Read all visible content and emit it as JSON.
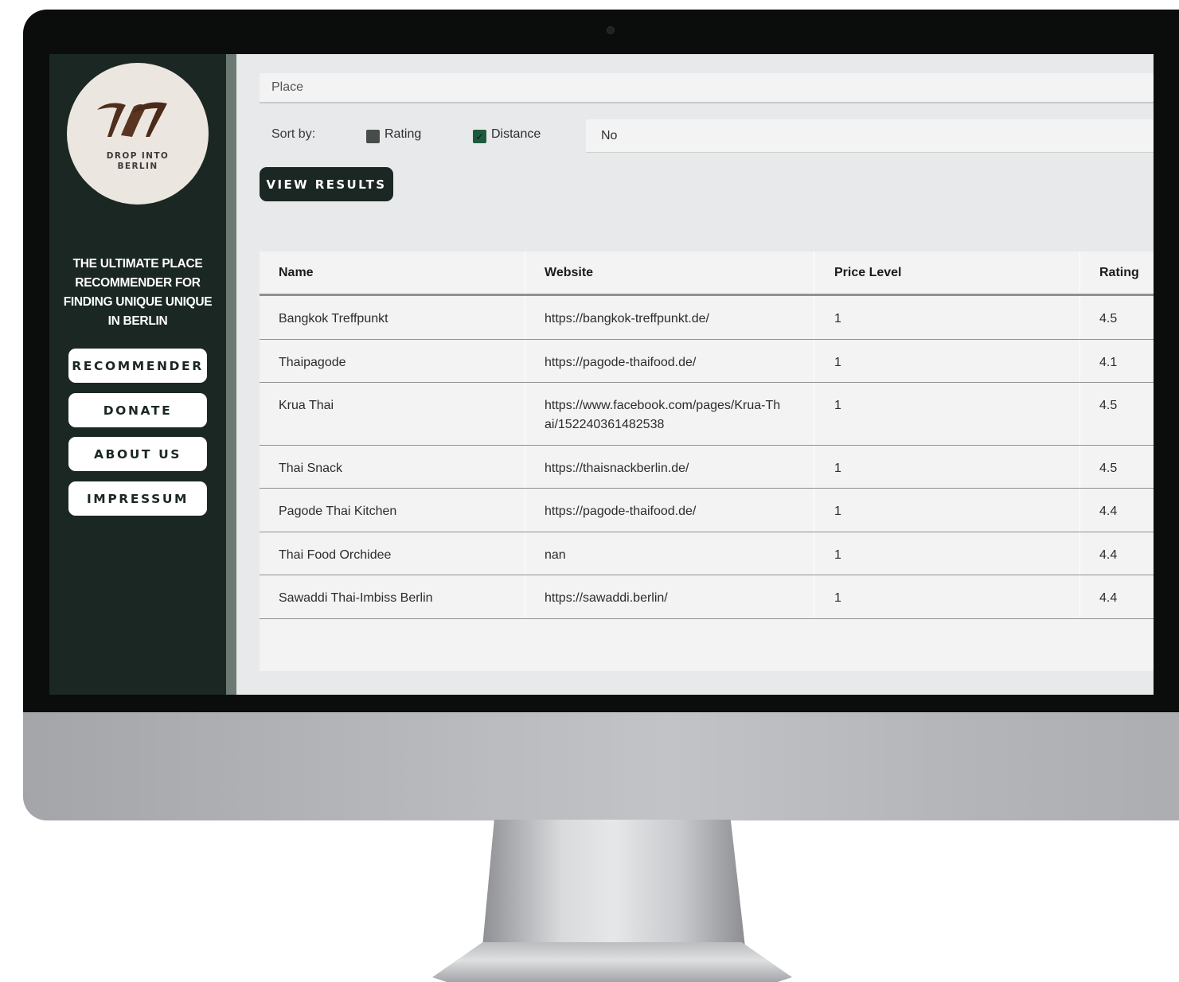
{
  "brand": {
    "logo_text": "DROP INTO BERLIN",
    "tagline": "THE ULTIMATE PLACE RECOMMENDER FOR FINDING UNIQUE UNIQUE IN BERLIN"
  },
  "nav": {
    "items": [
      {
        "label": "RECOMMENDER"
      },
      {
        "label": "DONATE"
      },
      {
        "label": "ABOUT US"
      },
      {
        "label": "IMPRESSUM"
      }
    ]
  },
  "search": {
    "placeholder": "Place"
  },
  "sort": {
    "label": "Sort by:",
    "options": [
      {
        "label": "Rating",
        "checked": false
      },
      {
        "label": "Distance",
        "checked": true
      }
    ],
    "select_value": "No"
  },
  "actions": {
    "view_results_label": "VIEW RESULTS"
  },
  "colors": {
    "sidebar": "#1b2723",
    "accent": "#1f5a3d",
    "background": "#e8e9ea"
  },
  "table": {
    "columns": [
      "Name",
      "Website",
      "Price Level",
      "Rating"
    ],
    "rows": [
      [
        "Bangkok Treffpunkt",
        "https://bangkok-treffpunkt.de/",
        "1",
        "4.5"
      ],
      [
        "Thaipagode",
        "https://pagode-thaifood.de/",
        "1",
        "4.1"
      ],
      [
        "Krua Thai",
        "https://www.facebook.com/pages/Krua-Thai/152240361482538",
        "1",
        "4.5"
      ],
      [
        "Thai Snack",
        "https://thaisnackberlin.de/",
        "1",
        "4.5"
      ],
      [
        "Pagode Thai Kitchen",
        "https://pagode-thaifood.de/",
        "1",
        "4.4"
      ],
      [
        "Thai Food Orchidee",
        "nan",
        "1",
        "4.4"
      ],
      [
        "Sawaddi Thai-Imbiss Berlin",
        "https://sawaddi.berlin/",
        "1",
        "4.4"
      ]
    ]
  }
}
